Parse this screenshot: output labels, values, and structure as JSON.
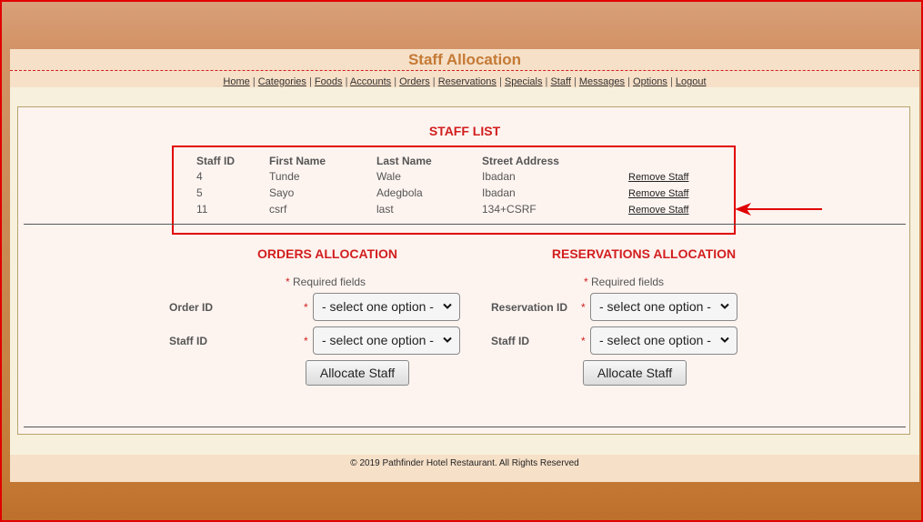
{
  "header": {
    "title": "Staff Allocation"
  },
  "nav": {
    "items": [
      "Home",
      "Categories",
      "Foods",
      "Accounts",
      "Orders",
      "Reservations",
      "Specials",
      "Staff",
      "Messages",
      "Options",
      "Logout"
    ],
    "separator": "|"
  },
  "staff_list": {
    "heading": "STAFF LIST",
    "columns": [
      "Staff ID",
      "First Name",
      "Last Name",
      "Street Address"
    ],
    "rows": [
      {
        "id": "4",
        "first": "Tunde",
        "last": "Wale",
        "address": "Ibadan",
        "action": "Remove Staff"
      },
      {
        "id": "5",
        "first": "Sayo",
        "last": "Adegbola",
        "address": "Ibadan",
        "action": "Remove Staff"
      },
      {
        "id": "11",
        "first": "csrf",
        "last": "last",
        "address": "134+CSRF",
        "action": "Remove Staff"
      }
    ]
  },
  "orders": {
    "heading": "ORDERS ALLOCATION",
    "required_star": "*",
    "required_text": " Required fields",
    "order_label": "Order ID",
    "staff_label": "Staff ID",
    "select_placeholder": "- select one option -",
    "button": "Allocate Staff"
  },
  "reservations": {
    "heading": "RESERVATIONS ALLOCATION",
    "required_star": "*",
    "required_text": " Required fields",
    "reservation_label": "Reservation ID",
    "staff_label": "Staff ID",
    "select_placeholder": "- select one option -",
    "button": "Allocate Staff"
  },
  "footer": {
    "text": "© 2019 Pathfinder Hotel Restaurant. All Rights Reserved"
  },
  "colors": {
    "accent": "#c47a35",
    "heading_red": "#d21e1e",
    "highlight_red": "#e00000"
  }
}
